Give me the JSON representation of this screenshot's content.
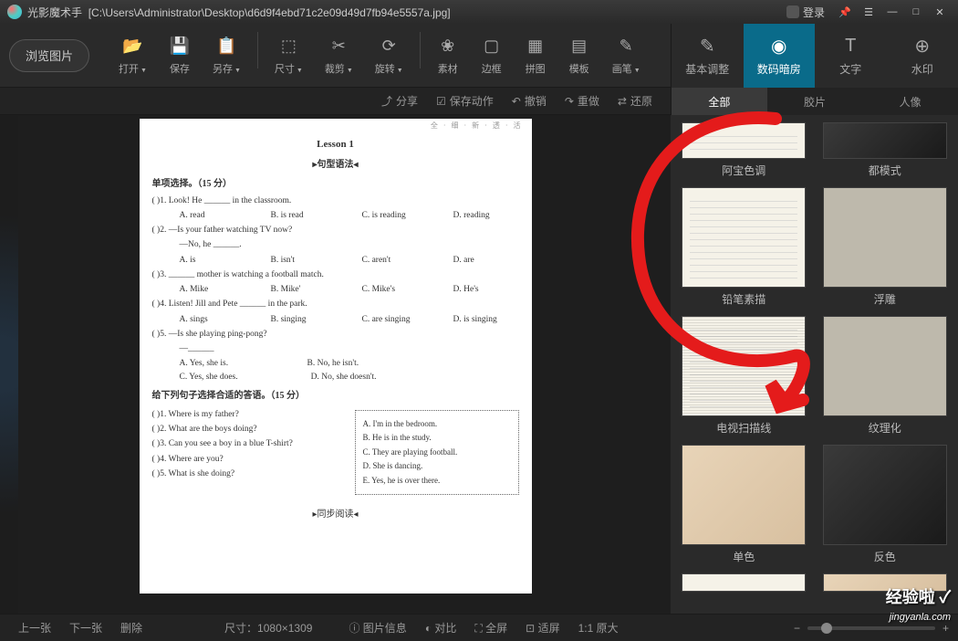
{
  "titlebar": {
    "app_name": "光影魔术手",
    "file_path": "[C:\\Users\\Administrator\\Desktop\\d6d9f4ebd71c2e09d49d7fb94e5557a.jpg]",
    "login_label": "登录"
  },
  "toolbar": {
    "browse_label": "浏览图片",
    "items": [
      {
        "label": "打开",
        "icon": "📂"
      },
      {
        "label": "保存",
        "icon": "💾"
      },
      {
        "label": "另存",
        "icon": "📋"
      },
      {
        "label": "尺寸",
        "icon": "⬚"
      },
      {
        "label": "裁剪",
        "icon": "✂"
      },
      {
        "label": "旋转",
        "icon": "⟳"
      },
      {
        "label": "素材",
        "icon": "❀"
      },
      {
        "label": "边框",
        "icon": "▢"
      },
      {
        "label": "拼图",
        "icon": "▦"
      },
      {
        "label": "模板",
        "icon": "▤"
      },
      {
        "label": "画笔",
        "icon": "✎"
      }
    ]
  },
  "right_tabs": [
    {
      "label": "基本调整",
      "icon": "✎"
    },
    {
      "label": "数码暗房",
      "icon": "◉",
      "active": true
    },
    {
      "label": "文字",
      "icon": "T"
    },
    {
      "label": "水印",
      "icon": "⊕"
    }
  ],
  "subbar": {
    "share": "分享",
    "save_action": "保存动作",
    "undo": "撤销",
    "redo": "重做",
    "restore": "还原"
  },
  "filter_tabs": [
    {
      "label": "全部",
      "active": true
    },
    {
      "label": "胶片"
    },
    {
      "label": "人像"
    }
  ],
  "filters": [
    {
      "label": "阿宝色调",
      "class": "doc"
    },
    {
      "label": "都模式",
      "class": "dark"
    },
    {
      "label": "铅笔素描",
      "class": "doc"
    },
    {
      "label": "浮雕",
      "class": "emboss"
    },
    {
      "label": "电视扫描线",
      "class": "doc tv"
    },
    {
      "label": "纹理化",
      "class": "emboss"
    },
    {
      "label": "单色",
      "class": "warm"
    },
    {
      "label": "反色",
      "class": "dark"
    }
  ],
  "bottom": {
    "prev": "上一张",
    "next": "下一张",
    "delete": "删除",
    "size_label": "尺寸：1080×1309",
    "img_info": "图片信息",
    "compare": "对比",
    "fullscreen": "全屏",
    "fit": "适屏",
    "original": "原大"
  },
  "document": {
    "watermark_right": "全 · 细 · 新 · 透 · 活",
    "lesson": "Lesson 1",
    "grammar": "句型语法",
    "section1": "单项选择。（15 分）",
    "q1": "( )1. Look! He ______ in the classroom.",
    "q1_opts": [
      "A. read",
      "B. is read",
      "C. is reading",
      "D. reading"
    ],
    "q2": "( )2. —Is your father watching TV now?",
    "q2_2": "—No, he ______.",
    "q2_opts": [
      "A. is",
      "B. isn't",
      "C. aren't",
      "D. are"
    ],
    "q3": "( )3. ______ mother is watching a football match.",
    "q3_opts": [
      "A. Mike",
      "B. Mike'",
      "C. Mike's",
      "D. He's"
    ],
    "q4": "( )4. Listen! Jill and Pete ______ in the park.",
    "q4_opts": [
      "A. sings",
      "B. singing",
      "C. are singing",
      "D. is singing"
    ],
    "q5": "( )5. —Is she playing ping-pong?",
    "q5_2": "—______",
    "q5_opts": [
      "A. Yes, she is.",
      "B. No, he isn't.",
      "C. Yes, she does.",
      "D. No, she doesn't."
    ],
    "section2": "给下列句子选择合适的答语。（15 分）",
    "s2_q1": "( )1. Where is my father?",
    "s2_q2": "( )2. What are the boys doing?",
    "s2_q3": "( )3. Can you see a boy in a blue T-shirt?",
    "s2_q4": "( )4. Where are you?",
    "s2_q5": "( )5. What is she doing?",
    "ans_a": "A. I'm in the bedroom.",
    "ans_b": "B. He is in the study.",
    "ans_c": "C. They are playing football.",
    "ans_d": "D. She is dancing.",
    "ans_e": "E. Yes, he is over there.",
    "reading": "同步阅读"
  },
  "watermark": {
    "logo": "经验啦 ✓",
    "url": "jingyanla.com"
  }
}
